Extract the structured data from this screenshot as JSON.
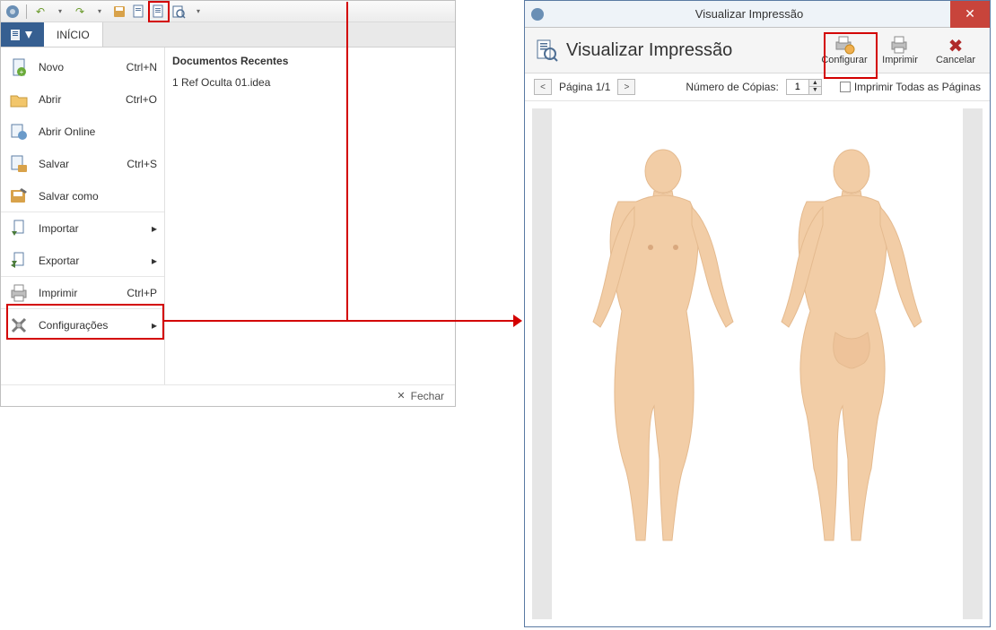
{
  "toolbar_icons": [
    "app",
    "undo",
    "redo",
    "save",
    "doc",
    "doc2",
    "preview"
  ],
  "tab_inicio": "INÍCIO",
  "menu": {
    "novo": {
      "label": "Novo",
      "shortcut": "Ctrl+N"
    },
    "abrir": {
      "label": "Abrir",
      "shortcut": "Ctrl+O"
    },
    "abrir_online": {
      "label": "Abrir Online",
      "shortcut": ""
    },
    "salvar": {
      "label": "Salvar",
      "shortcut": "Ctrl+S"
    },
    "salvar_como": {
      "label": "Salvar como",
      "shortcut": ""
    },
    "importar": {
      "label": "Importar",
      "shortcut": ""
    },
    "exportar": {
      "label": "Exportar",
      "shortcut": ""
    },
    "imprimir": {
      "label": "Imprimir",
      "shortcut": "Ctrl+P"
    },
    "config": {
      "label": "Configurações",
      "shortcut": ""
    }
  },
  "recent_header": "Documentos Recentes",
  "recent_items": [
    "1 Ref Oculta 01.idea"
  ],
  "footer_close": "Fechar",
  "dialog": {
    "window_title": "Visualizar Impressão",
    "header_title": "Visualizar Impressão",
    "actions": {
      "configurar": "Configurar",
      "imprimir": "Imprimir",
      "cancelar": "Cancelar"
    },
    "page_label": "Página 1/1",
    "copies_label": "Número de Cópias:",
    "copies_value": "1",
    "print_all": "Imprimir Todas as Páginas"
  }
}
